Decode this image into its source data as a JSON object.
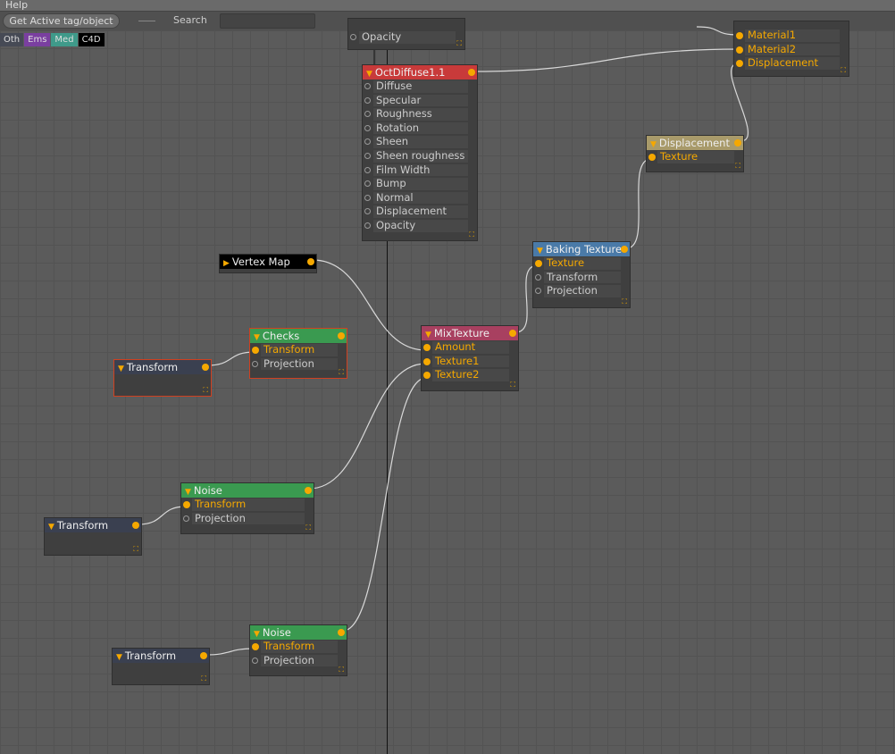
{
  "menu": {
    "help": "Help"
  },
  "toolbar": {
    "get_active": "Get Active tag/object",
    "search_label": "Search",
    "search_value": ""
  },
  "tags": [
    {
      "label": "Oth",
      "color": "#464a55"
    },
    {
      "label": "Ems",
      "color": "#7a3fa0"
    },
    {
      "label": "Med",
      "color": "#3f9a8a"
    },
    {
      "label": "C4D",
      "color": "#000000"
    }
  ],
  "nodes": [
    {
      "title": "",
      "color": "#3f3f3f",
      "output": false,
      "ports": [
        {
          "label": "Opacity",
          "connected": false
        }
      ]
    },
    {
      "title": "OctDiffuse1.1",
      "color": "#c83a3a",
      "output": true,
      "ports": [
        {
          "label": "Diffuse"
        },
        {
          "label": "Specular"
        },
        {
          "label": "Roughness"
        },
        {
          "label": "Rotation"
        },
        {
          "label": "Sheen"
        },
        {
          "label": "Sheen roughness"
        },
        {
          "label": "Film Width"
        },
        {
          "label": "Bump"
        },
        {
          "label": "Normal"
        },
        {
          "label": "Displacement"
        },
        {
          "label": "Opacity"
        }
      ]
    },
    {
      "title": "",
      "color": "#3f3f3f",
      "output": false,
      "ports": [
        {
          "label": "Material1",
          "connected": true
        },
        {
          "label": "Material2",
          "connected": true
        },
        {
          "label": "Displacement",
          "connected": true
        }
      ]
    },
    {
      "title": "Displacement",
      "color": "#a89a6a",
      "output": true,
      "ports": [
        {
          "label": "Texture",
          "connected": true
        }
      ]
    },
    {
      "title": "Baking Texture",
      "color": "#4a7aa8",
      "output": true,
      "ports": [
        {
          "label": "Texture",
          "connected": true
        },
        {
          "label": "Transform"
        },
        {
          "label": "Projection"
        }
      ]
    },
    {
      "title": "Vertex Map",
      "color": "#000000",
      "output": true,
      "collapsed": true,
      "ports": []
    },
    {
      "title": "Checks",
      "color": "#3a9a50",
      "output": true,
      "ports": [
        {
          "label": "Transform",
          "connected": true
        },
        {
          "label": "Projection"
        }
      ]
    },
    {
      "title": "Transform",
      "color": "#3a4050",
      "output": true,
      "ports": []
    },
    {
      "title": "MixTexture",
      "color": "#a84060",
      "output": true,
      "ports": [
        {
          "label": "Amount",
          "connected": true
        },
        {
          "label": "Texture1",
          "connected": true
        },
        {
          "label": "Texture2",
          "connected": true
        }
      ]
    },
    {
      "title": "Noise",
      "color": "#3a9a50",
      "output": true,
      "ports": [
        {
          "label": "Transform",
          "connected": true
        },
        {
          "label": "Projection"
        }
      ]
    },
    {
      "title": "Transform",
      "color": "#3a4050",
      "output": true,
      "ports": []
    },
    {
      "title": "Noise",
      "color": "#3a9a50",
      "output": true,
      "ports": [
        {
          "label": "Transform",
          "connected": true
        },
        {
          "label": "Projection"
        }
      ]
    },
    {
      "title": "Transform",
      "color": "#3a4050",
      "output": true,
      "ports": []
    }
  ]
}
